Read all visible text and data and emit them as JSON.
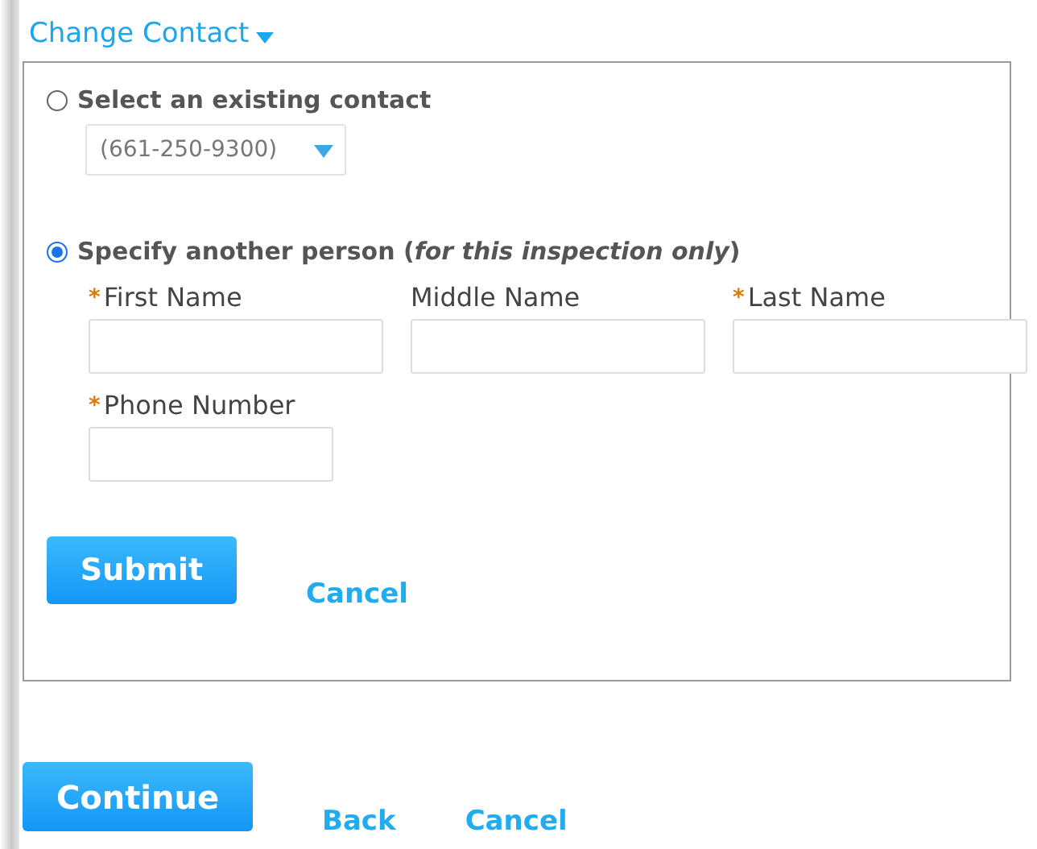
{
  "header": {
    "title": "Change Contact"
  },
  "options": [
    {
      "kind": "select",
      "label": "Select an existing contact",
      "selected": false,
      "value": "(661-250-9300)"
    },
    {
      "kind": "person",
      "label": "Specify another person (*for this inspection only*)",
      "selected": true,
      "field_rows": [
        [
          {
            "label": "First Name",
            "required_mark": "*"
          },
          {
            "label": "Middle Name"
          },
          {
            "label": "Last Name",
            "required_mark": "*"
          }
        ],
        [
          {
            "label": "Phone Number",
            "required_mark": "*"
          }
        ]
      ]
    }
  ],
  "panel_actions": {
    "submit": "Submit",
    "cancel": "Cancel"
  },
  "footer_actions": {
    "continue": "Continue",
    "back": "Back",
    "cancel": "Cancel"
  }
}
